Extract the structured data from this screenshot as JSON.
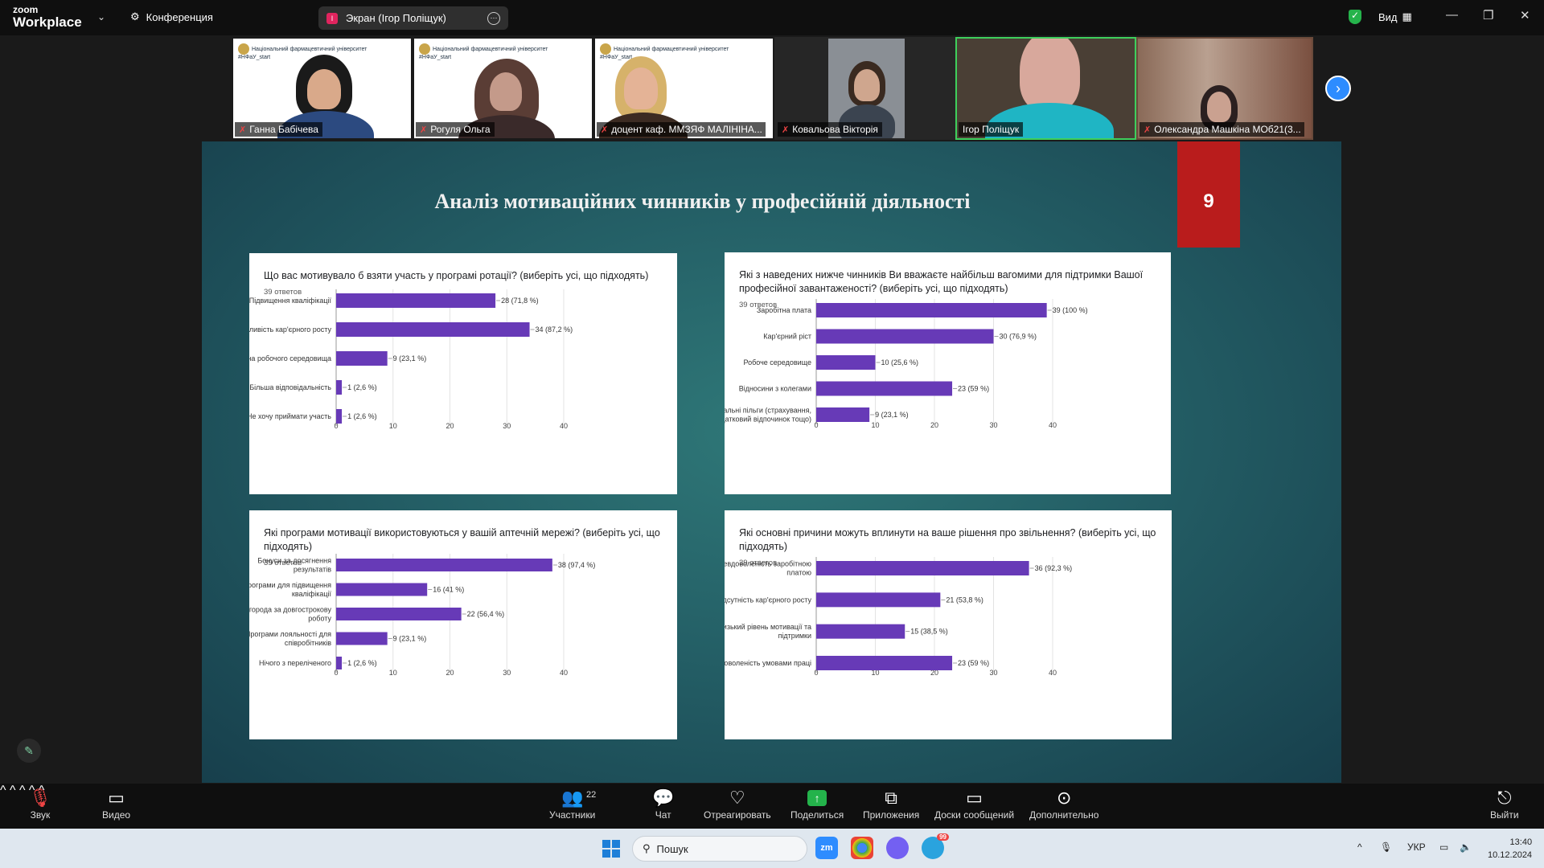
{
  "topbar": {
    "logo_line1": "zoom",
    "logo_line2": "Workplace",
    "conference_label": "Конференция",
    "share_title": "Экран (Ігор Поліщук)",
    "share_badge": "I",
    "view_label": "Вид"
  },
  "thumbnails": [
    {
      "name": "Ганна Бабічева",
      "uni": "Національний фармацевтичний університет",
      "tag": "#НФаУ_start"
    },
    {
      "name": "Рогуля Ольга",
      "uni": "Національний фармацевтичний університет",
      "tag": "#НФаУ_start"
    },
    {
      "name": "доцент каф. ММЗЯФ МАЛІНІНА...",
      "uni": "Національний фармацевтичний університет",
      "tag": "#НФаУ_start"
    },
    {
      "name": "Ковальова Вікторія"
    },
    {
      "name": "Ігор Поліщук"
    },
    {
      "name": "Олександра Машкіна МОб21(3..."
    }
  ],
  "slide": {
    "title": "Аналіз мотиваційних чинників у професійній діяльності",
    "number": "9"
  },
  "charts": [
    {
      "question": "Що вас мотивувало б взяти участь у програмі ротації? (виберіть усі, що підходять)",
      "count": "39 ответов",
      "categories": [
        [
          "Підвищення кваліфікації"
        ],
        [
          "Можливість кар'єрного росту"
        ],
        [
          "Зміна робочого середовища"
        ],
        [
          "Більша відповідальність"
        ],
        [
          "Не хочу приймати участь"
        ]
      ],
      "values": [
        28,
        34,
        9,
        1,
        1
      ],
      "labels": [
        "28 (71,8 %)",
        "34 (87,2 %)",
        "9 (23,1 %)",
        "1 (2,6 %)",
        "1 (2,6 %)"
      ],
      "ticks": [
        "0",
        "10",
        "20",
        "30",
        "40"
      ]
    },
    {
      "question": "Які з наведених нижче чинників Ви вважаєте найбільш вагомими для підтримки Вашої професійної завантаженості? (виберіть усі, що підходять)",
      "count": "39 ответов",
      "categories": [
        [
          "Заробітна плата"
        ],
        [
          "Кар'єрний ріст"
        ],
        [
          "Робоче середовище"
        ],
        [
          "Відносини з колегами"
        ],
        [
          "Соціальні пільги (страхування,",
          "додатковий відпочинок тощо)"
        ]
      ],
      "values": [
        39,
        30,
        10,
        23,
        9
      ],
      "labels": [
        "39 (100 %)",
        "30 (76,9 %)",
        "10 (25,6 %)",
        "23 (59 %)",
        "9 (23,1 %)"
      ],
      "ticks": [
        "0",
        "10",
        "20",
        "30",
        "40"
      ]
    },
    {
      "question": "Які програми мотивації використовуються у вашій аптечній мережі? (виберіть усі, що підходять)",
      "count": "39 ответов",
      "categories": [
        [
          "Бонуси за досягнення",
          "результатів"
        ],
        [
          "Програми для підвищення",
          "кваліфікації"
        ],
        [
          "Винагорода за довгострокову",
          "роботу"
        ],
        [
          "Програми лояльності для",
          "співробітників"
        ],
        [
          "Нічого з переліченого"
        ]
      ],
      "values": [
        38,
        16,
        22,
        9,
        1
      ],
      "labels": [
        "38 (97,4 %)",
        "16 (41 %)",
        "22 (56,4 %)",
        "9 (23,1 %)",
        "1 (2,6 %)"
      ],
      "ticks": [
        "0",
        "10",
        "20",
        "30",
        "40"
      ]
    },
    {
      "question": "Які основні причини можуть вплинути на ваше рішення про звільнення? (виберіть усі, що підходять)",
      "count": "39 ответов",
      "categories": [
        [
          "Невдоволеність заробітною",
          "платою"
        ],
        [
          "Відсутність кар'єрного росту"
        ],
        [
          "Низький рівень мотивації та",
          "підтримки"
        ],
        [
          "Невдоволеність умовами праці"
        ]
      ],
      "values": [
        36,
        21,
        15,
        23
      ],
      "labels": [
        "36 (92,3 %)",
        "21 (53,8 %)",
        "15 (38,5 %)",
        "23 (59 %)"
      ],
      "ticks": [
        "0",
        "10",
        "20",
        "30",
        "40"
      ]
    }
  ],
  "chart_data": [
    {
      "type": "bar",
      "title": "Що вас мотивувало б взяти участь у програмі ротації? (виберіть усі, що підходять)",
      "categories": [
        "Підвищення кваліфікації",
        "Можливість кар'єрного росту",
        "Зміна робочого середовища",
        "Більша відповідальність",
        "Не хочу приймати участь"
      ],
      "values": [
        28,
        34,
        9,
        1,
        1
      ],
      "xlim": [
        0,
        40
      ],
      "orientation": "horizontal"
    },
    {
      "type": "bar",
      "title": "Які з наведених нижче чинників Ви вважаєте найбільш вагомими для підтримки Вашої професійної завантаженості? (виберіть усі, що підходять)",
      "categories": [
        "Заробітна плата",
        "Кар'єрний ріст",
        "Робоче середовище",
        "Відносини з колегами",
        "Соціальні пільги (страхування, додатковий відпочинок тощо)"
      ],
      "values": [
        39,
        30,
        10,
        23,
        9
      ],
      "xlim": [
        0,
        40
      ],
      "orientation": "horizontal"
    },
    {
      "type": "bar",
      "title": "Які програми мотивації використовуються у вашій аптечній мережі? (виберіть усі, що підходять)",
      "categories": [
        "Бонуси за досягнення результатів",
        "Програми для підвищення кваліфікації",
        "Винагорода за довгострокову роботу",
        "Програми лояльності для співробітників",
        "Нічого з переліченого"
      ],
      "values": [
        38,
        16,
        22,
        9,
        1
      ],
      "xlim": [
        0,
        40
      ],
      "orientation": "horizontal"
    },
    {
      "type": "bar",
      "title": "Які основні причини можуть вплинути на ваше рішення про звільнення? (виберіть усі, що підходять)",
      "categories": [
        "Невдоволеність заробітною платою",
        "Відсутність кар'єрного росту",
        "Низький рівень мотивації та підтримки",
        "Невдоволеність умовами праці"
      ],
      "values": [
        36,
        21,
        15,
        23
      ],
      "xlim": [
        0,
        40
      ],
      "orientation": "horizontal"
    }
  ],
  "toolbar": {
    "audio": "Звук",
    "video": "Видео",
    "participants": "Участники",
    "participants_count": "22",
    "chat": "Чат",
    "react": "Отреагировать",
    "share": "Поделиться",
    "apps": "Приложения",
    "boards": "Доски сообщений",
    "more": "Дополнительно",
    "leave": "Выйти"
  },
  "taskbar": {
    "search_placeholder": "Пошук",
    "lang": "УКР",
    "time": "13:40",
    "date": "10.12.2024",
    "zoom_app": "zm",
    "telegram_badge": "99"
  },
  "colors": {
    "bar": "#673ab7",
    "accent": "#2d8cff",
    "slide_number_bg": "#b91c1c"
  }
}
